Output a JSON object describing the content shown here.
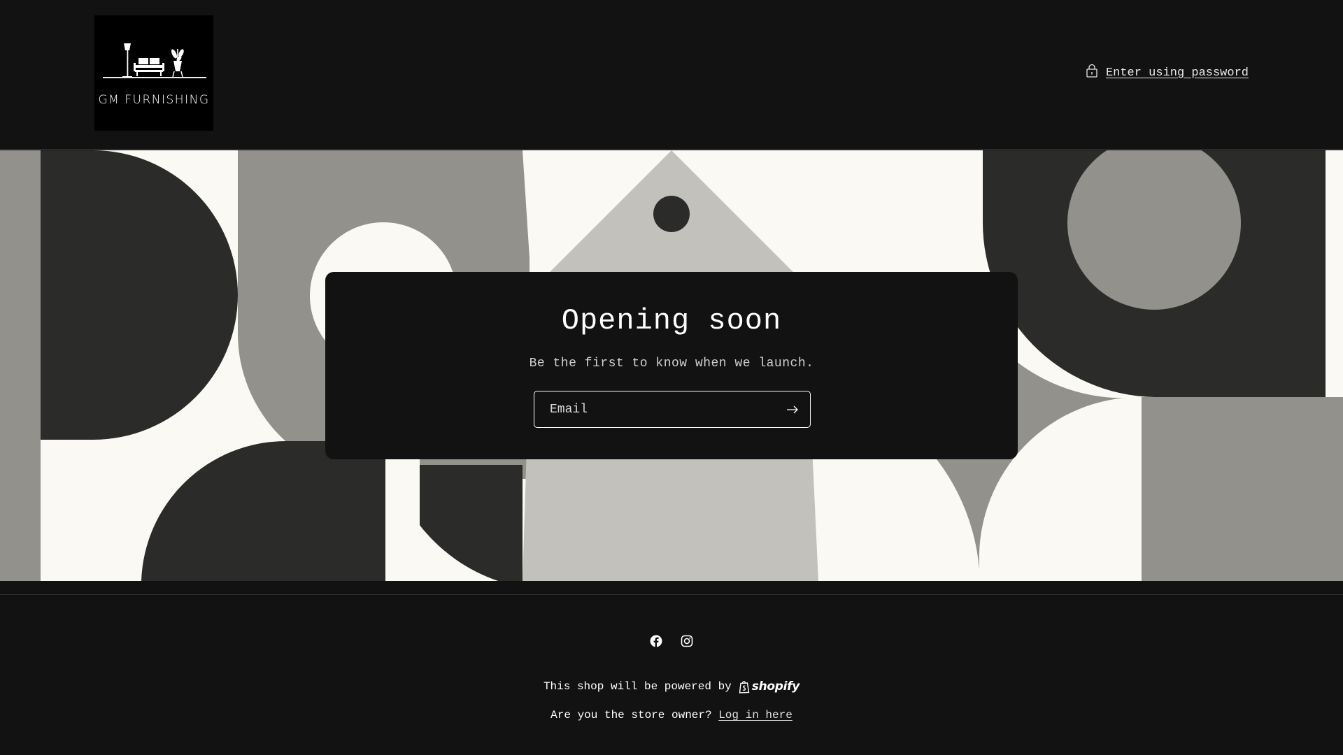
{
  "header": {
    "logo_text": "GM FURNISHING",
    "password_link": "Enter using password"
  },
  "card": {
    "title": "Opening soon",
    "subtitle": "Be the first to know when we launch.",
    "email_placeholder": "Email"
  },
  "footer": {
    "socials": [
      "facebook-icon",
      "instagram-icon"
    ],
    "powered_text": "This shop will be powered by",
    "powered_brand": "shopify",
    "owner_text": "Are you the store owner?",
    "login_link": "Log in here"
  },
  "colors": {
    "background": "#121212",
    "banner_light": "#faf9f4",
    "banner_dark": "#2b2b29",
    "banner_mid": "#92918c",
    "banner_pale": "#c2c1bc"
  }
}
